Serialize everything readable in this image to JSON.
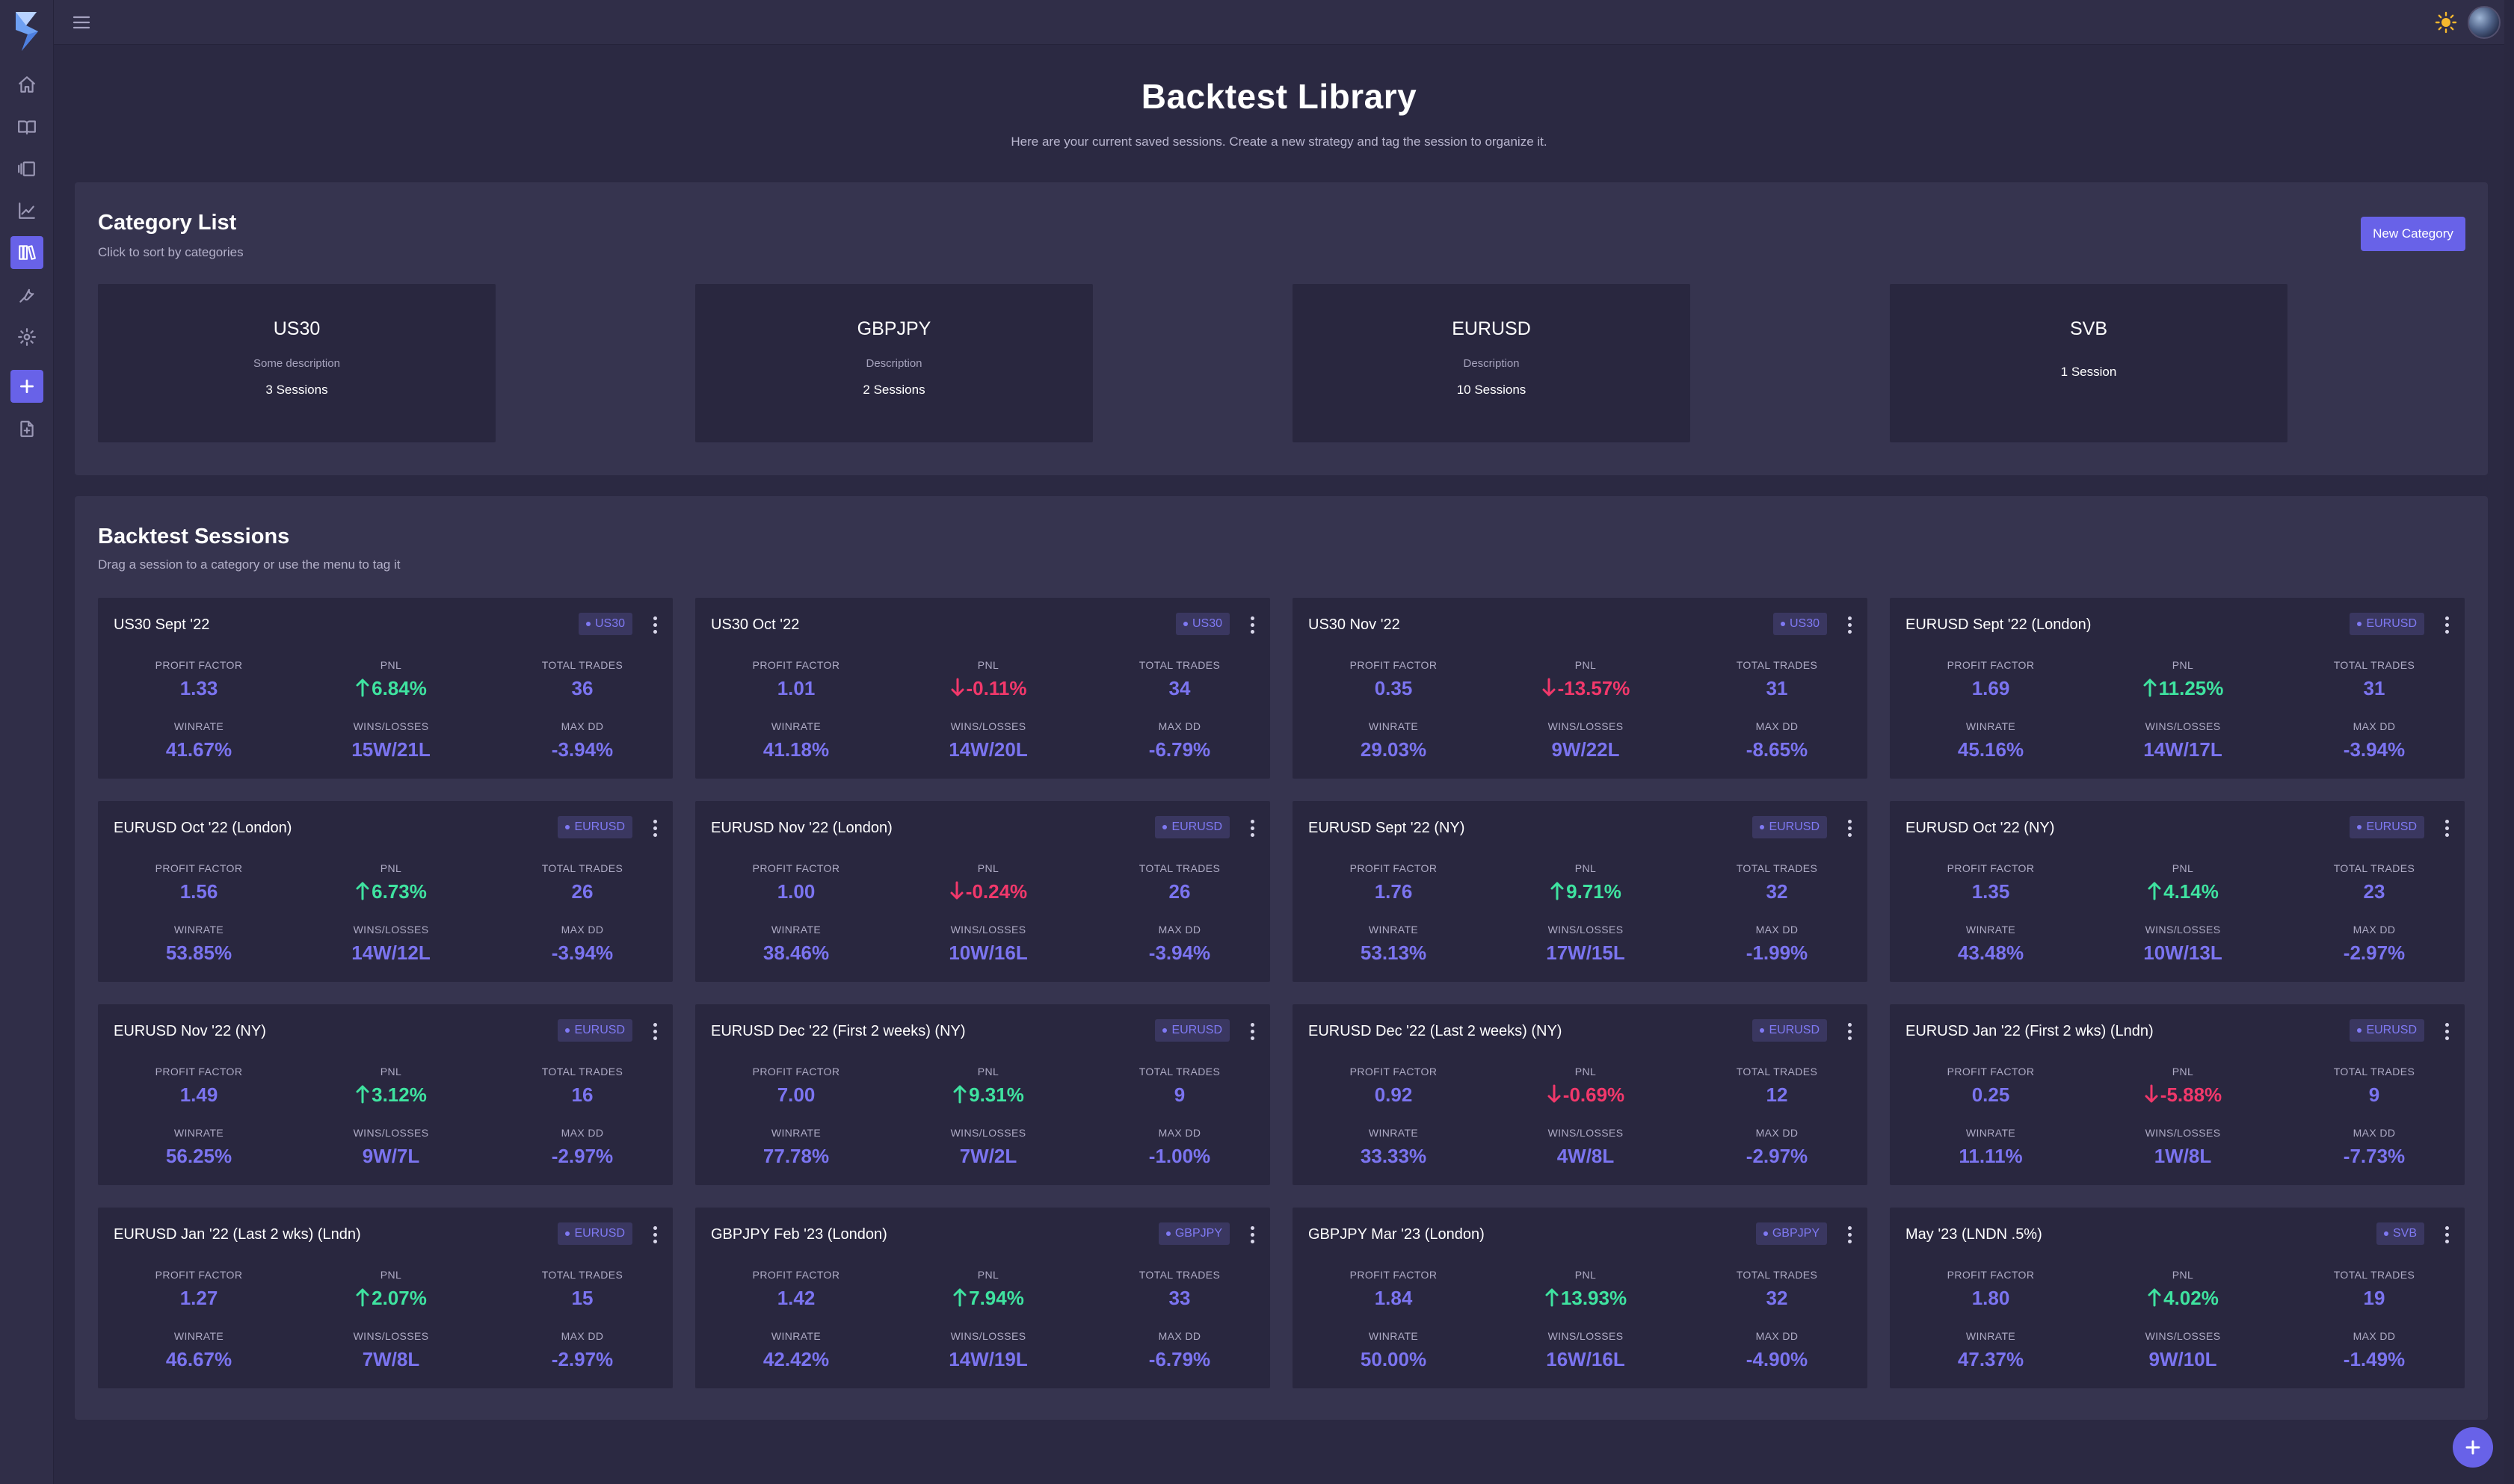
{
  "header": {
    "title": "Backtest Library",
    "subtitle": "Here are your current saved sessions. Create a new strategy and tag the session to organize it."
  },
  "sidebar": {
    "items": [
      {
        "icon": "home-icon"
      },
      {
        "icon": "book-open-icon"
      },
      {
        "icon": "layout-panels-icon"
      },
      {
        "icon": "line-chart-icon"
      },
      {
        "icon": "library-icon",
        "active": true
      },
      {
        "icon": "wrench-icon"
      },
      {
        "icon": "gear-icon"
      },
      {
        "icon": "plus-icon"
      },
      {
        "icon": "file-import-icon"
      }
    ],
    "accent": "#6862e8"
  },
  "topbar": {
    "theme_icon": "sun-icon",
    "avatar": "user-avatar"
  },
  "categories": {
    "title": "Category List",
    "subtitle": "Click to sort by categories",
    "new_button": "New Category",
    "items": [
      {
        "name": "US30",
        "description": "Some description",
        "count": "3 Sessions"
      },
      {
        "name": "GBPJPY",
        "description": "Description",
        "count": "2 Sessions"
      },
      {
        "name": "EURUSD",
        "description": "Description",
        "count": "10 Sessions"
      },
      {
        "name": "SVB",
        "description": "",
        "count": "1 Session"
      }
    ]
  },
  "sessions": {
    "title": "Backtest Sessions",
    "subtitle": "Drag a session to a category or use the menu to tag it",
    "labels": {
      "profit_factor": "PROFIT FACTOR",
      "pnl": "PNL",
      "total_trades": "TOTAL TRADES",
      "winrate": "WINRATE",
      "wins_losses": "WINS/LOSSES",
      "max_dd": "MAX DD"
    },
    "items": [
      {
        "title": "US30 Sept '22",
        "tag": "US30",
        "pf": "1.33",
        "pnl": "6.84%",
        "pnl_dir": "up",
        "trades": "36",
        "winrate": "41.67%",
        "wl": "15W/21L",
        "dd": "-3.94%"
      },
      {
        "title": "US30 Oct '22",
        "tag": "US30",
        "pf": "1.01",
        "pnl": "-0.11%",
        "pnl_dir": "down",
        "trades": "34",
        "winrate": "41.18%",
        "wl": "14W/20L",
        "dd": "-6.79%"
      },
      {
        "title": "US30 Nov '22",
        "tag": "US30",
        "pf": "0.35",
        "pnl": "-13.57%",
        "pnl_dir": "down",
        "trades": "31",
        "winrate": "29.03%",
        "wl": "9W/22L",
        "dd": "-8.65%"
      },
      {
        "title": "EURUSD Sept '22 (London)",
        "tag": "EURUSD",
        "pf": "1.69",
        "pnl": "11.25%",
        "pnl_dir": "up",
        "trades": "31",
        "winrate": "45.16%",
        "wl": "14W/17L",
        "dd": "-3.94%"
      },
      {
        "title": "EURUSD Oct '22 (London)",
        "tag": "EURUSD",
        "pf": "1.56",
        "pnl": "6.73%",
        "pnl_dir": "up",
        "trades": "26",
        "winrate": "53.85%",
        "wl": "14W/12L",
        "dd": "-3.94%"
      },
      {
        "title": "EURUSD Nov '22 (London)",
        "tag": "EURUSD",
        "pf": "1.00",
        "pnl": "-0.24%",
        "pnl_dir": "down",
        "trades": "26",
        "winrate": "38.46%",
        "wl": "10W/16L",
        "dd": "-3.94%"
      },
      {
        "title": "EURUSD Sept '22 (NY)",
        "tag": "EURUSD",
        "pf": "1.76",
        "pnl": "9.71%",
        "pnl_dir": "up",
        "trades": "32",
        "winrate": "53.13%",
        "wl": "17W/15L",
        "dd": "-1.99%"
      },
      {
        "title": "EURUSD Oct '22 (NY)",
        "tag": "EURUSD",
        "pf": "1.35",
        "pnl": "4.14%",
        "pnl_dir": "up",
        "trades": "23",
        "winrate": "43.48%",
        "wl": "10W/13L",
        "dd": "-2.97%"
      },
      {
        "title": "EURUSD Nov '22 (NY)",
        "tag": "EURUSD",
        "pf": "1.49",
        "pnl": "3.12%",
        "pnl_dir": "up",
        "trades": "16",
        "winrate": "56.25%",
        "wl": "9W/7L",
        "dd": "-2.97%"
      },
      {
        "title": "EURUSD Dec '22 (First 2 weeks) (NY)",
        "tag": "EURUSD",
        "pf": "7.00",
        "pnl": "9.31%",
        "pnl_dir": "up",
        "trades": "9",
        "winrate": "77.78%",
        "wl": "7W/2L",
        "dd": "-1.00%"
      },
      {
        "title": "EURUSD Dec '22 (Last 2 weeks) (NY)",
        "tag": "EURUSD",
        "pf": "0.92",
        "pnl": "-0.69%",
        "pnl_dir": "down",
        "trades": "12",
        "winrate": "33.33%",
        "wl": "4W/8L",
        "dd": "-2.97%"
      },
      {
        "title": "EURUSD Jan '22 (First 2 wks) (Lndn)",
        "tag": "EURUSD",
        "pf": "0.25",
        "pnl": "-5.88%",
        "pnl_dir": "down",
        "trades": "9",
        "winrate": "11.11%",
        "wl": "1W/8L",
        "dd": "-7.73%"
      },
      {
        "title": "EURUSD Jan '22 (Last 2 wks) (Lndn)",
        "tag": "EURUSD",
        "pf": "1.27",
        "pnl": "2.07%",
        "pnl_dir": "up",
        "trades": "15",
        "winrate": "46.67%",
        "wl": "7W/8L",
        "dd": "-2.97%"
      },
      {
        "title": "GBPJPY Feb '23 (London)",
        "tag": "GBPJPY",
        "pf": "1.42",
        "pnl": "7.94%",
        "pnl_dir": "up",
        "trades": "33",
        "winrate": "42.42%",
        "wl": "14W/19L",
        "dd": "-6.79%"
      },
      {
        "title": "GBPJPY Mar '23 (London)",
        "tag": "GBPJPY",
        "pf": "1.84",
        "pnl": "13.93%",
        "pnl_dir": "up",
        "trades": "32",
        "winrate": "50.00%",
        "wl": "16W/16L",
        "dd": "-4.90%"
      },
      {
        "title": "May '23 (LNDN .5%)",
        "tag": "SVB",
        "pf": "1.80",
        "pnl": "4.02%",
        "pnl_dir": "up",
        "trades": "19",
        "winrate": "47.37%",
        "wl": "9W/10L",
        "dd": "-1.49%"
      }
    ]
  },
  "colors": {
    "positive": "#3fe3a0",
    "negative": "#f2386b",
    "value": "#7b74f0",
    "tag": "#7f79f3"
  }
}
